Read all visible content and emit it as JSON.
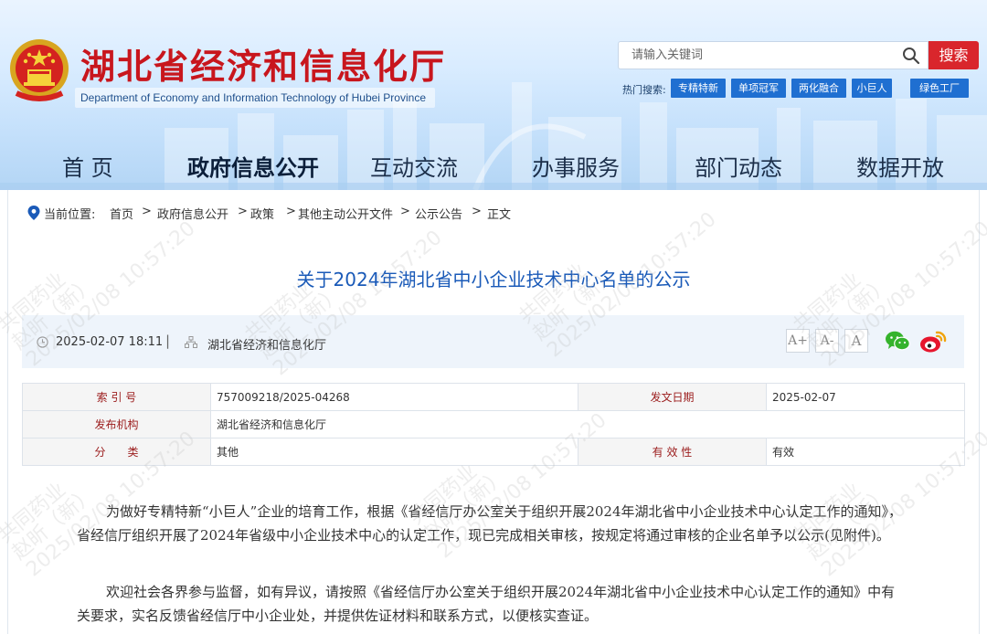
{
  "header": {
    "site_title": "湖北省经济和信息化厅",
    "site_subtitle": "Department of Economy and Information Technology of Hubei Province",
    "search": {
      "placeholder": "请输入关键词",
      "button_label": "搜索"
    },
    "hot_search_label": "热门搜索:",
    "hot_tags": [
      "专精特新",
      "单项冠军",
      "两化融合",
      "小巨人",
      "绿色工厂"
    ],
    "colors": {
      "title_red": "#c8161d",
      "search_red": "#d9262c",
      "tag_blue": "#1f6fd1"
    }
  },
  "nav": {
    "items": [
      "首 页",
      "政府信息公开",
      "互动交流",
      "办事服务",
      "部门动态",
      "数据开放"
    ],
    "active": "政府信息公开"
  },
  "breadcrumb": {
    "label": "当前位置:",
    "items": [
      "首页",
      "政府信息公开",
      "政策",
      "其他主动公开文件",
      "公示公告",
      "正文"
    ],
    "separator": ">"
  },
  "article": {
    "title": "关于2024年湖北省中小企业技术中心名单的公示",
    "date": "2025-02-07 18:11",
    "meta_separator": "|",
    "source": "湖北省经济和信息化厅",
    "font_size_buttons": [
      "A+",
      "A-",
      "A"
    ],
    "share_icons": [
      "wechat-icon",
      "weibo-icon"
    ]
  },
  "info_table": {
    "rows": [
      {
        "label1": "索 引 号",
        "value1": "757009218/2025-04268",
        "label2": "发文日期",
        "value2": "2025-02-07"
      },
      {
        "label1": "发布机构",
        "value1": "湖北省经济和信息化厅"
      },
      {
        "label1": "分　　类",
        "value1": "其他",
        "label2": "有 效 性",
        "value2": "有效"
      }
    ]
  },
  "body": {
    "paragraphs": [
      "为做好专精特新“小巨人”企业的培育工作，根据《省经信厅办公室关于组织开展2024年湖北省中小企业技术中心认定工作的通知》，省经信厅组织开展了2024年省级中小企业技术中心的认定工作，现已完成相关审核，按规定将通过审核的企业名单予以公示(见附件)。",
      "欢迎社会各界参与监督，如有异议，请按照《省经信厅办公室关于组织开展2024年湖北省中小企业技术中心认定工作的通知》中有关要求，实名反馈省经信厅中小企业处，并提供佐证材料和联系方式，以便核实查证。"
    ]
  },
  "watermark": {
    "line1": "共同药业",
    "line2": "赵昕（新）",
    "line3": "2025/02/08 10:57:20"
  }
}
